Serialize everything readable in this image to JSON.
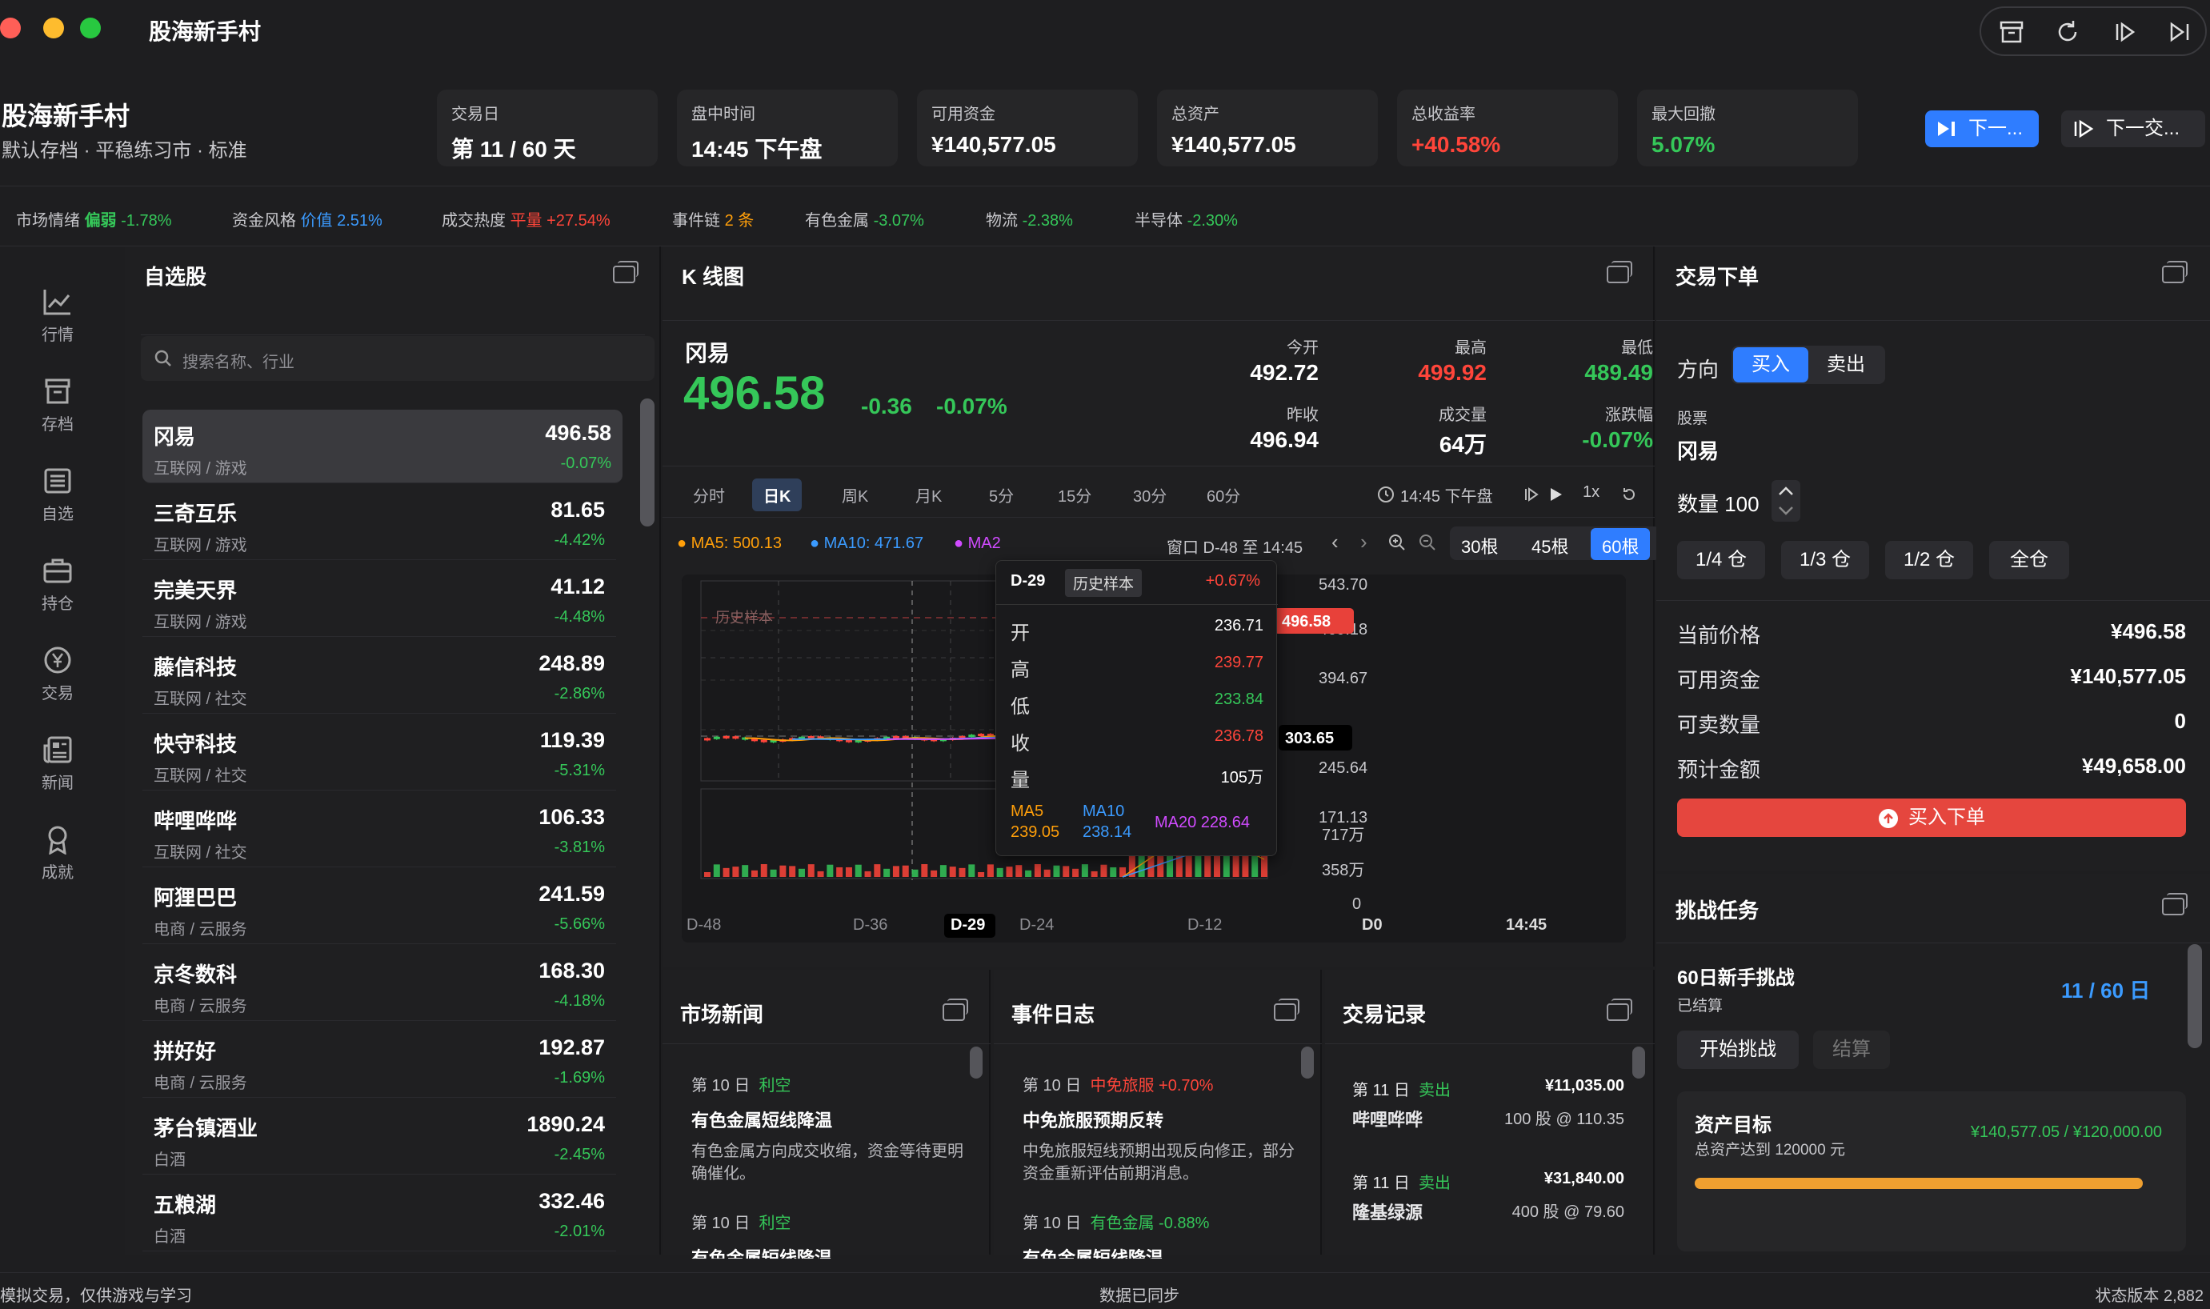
{
  "app": {
    "title": "股海新手村"
  },
  "header": {
    "title": "股海新手村",
    "subtitle": "默认存档 · 平稳练习市 · 标准",
    "stats": [
      {
        "label": "交易日",
        "value": "第 11 / 60 天"
      },
      {
        "label": "盘中时间",
        "value": "14:45 下午盘"
      },
      {
        "label": "可用资金",
        "value": "¥140,577.05"
      },
      {
        "label": "总资产",
        "value": "¥140,577.05"
      },
      {
        "label": "总收益率",
        "value": "+40.58%"
      },
      {
        "label": "最大回撤",
        "value": "5.07%"
      }
    ],
    "next_button": "下一...",
    "next_trade_button": "下一交..."
  },
  "ticker": [
    {
      "label": "市场情绪",
      "tag": "偏弱",
      "value": "-1.78%"
    },
    {
      "label": "资金风格",
      "tag": "价值",
      "value": "2.51%"
    },
    {
      "label": "成交热度",
      "tag": "平量",
      "value": "+27.54%"
    },
    {
      "label": "事件链",
      "tag": "",
      "value": "2 条"
    },
    {
      "label": "有色金属",
      "tag": "",
      "value": "-3.07%"
    },
    {
      "label": "物流",
      "tag": "",
      "value": "-2.38%"
    },
    {
      "label": "半导体",
      "tag": "",
      "value": "-2.30%"
    }
  ],
  "sidebar": {
    "items": [
      "行情",
      "存档",
      "自选",
      "持仓",
      "交易",
      "新闻",
      "成就"
    ]
  },
  "watchlist": {
    "title": "自选股",
    "search_placeholder": "搜索名称、行业",
    "stocks": [
      {
        "name": "冈易",
        "sector": "互联网 / 游戏",
        "price": "496.58",
        "change": "-0.07%"
      },
      {
        "name": "三奇互乐",
        "sector": "互联网 / 游戏",
        "price": "81.65",
        "change": "-4.42%"
      },
      {
        "name": "完美天界",
        "sector": "互联网 / 游戏",
        "price": "41.12",
        "change": "-4.48%"
      },
      {
        "name": "藤信科技",
        "sector": "互联网 / 社交",
        "price": "248.89",
        "change": "-2.86%"
      },
      {
        "name": "快守科技",
        "sector": "互联网 / 社交",
        "price": "119.39",
        "change": "-5.31%"
      },
      {
        "name": "哔哩哗哗",
        "sector": "互联网 / 社交",
        "price": "106.33",
        "change": "-3.81%"
      },
      {
        "name": "阿狸巴巴",
        "sector": "电商 / 云服务",
        "price": "241.59",
        "change": "-5.66%"
      },
      {
        "name": "京冬数科",
        "sector": "电商 / 云服务",
        "price": "168.30",
        "change": "-4.18%"
      },
      {
        "name": "拼好好",
        "sector": "电商 / 云服务",
        "price": "192.87",
        "change": "-1.69%"
      },
      {
        "name": "茅台镇酒业",
        "sector": "白酒",
        "price": "1890.24",
        "change": "-2.45%"
      },
      {
        "name": "五粮湖",
        "sector": "白酒",
        "price": "332.46",
        "change": "-2.01%"
      }
    ]
  },
  "kline": {
    "title": "K 线图",
    "stock_name": "冈易",
    "price": "496.58",
    "change": "-0.36",
    "change_pct": "-0.07%",
    "quote": [
      {
        "label": "今开",
        "value": "492.72"
      },
      {
        "label": "最高",
        "value": "499.92"
      },
      {
        "label": "最低",
        "value": "489.49"
      },
      {
        "label": "昨收",
        "value": "496.94"
      },
      {
        "label": "成交量",
        "value": "64万"
      },
      {
        "label": "涨跌幅",
        "value": "-0.07%"
      }
    ],
    "tabs": [
      "分时",
      "日K",
      "周K",
      "月K",
      "5分",
      "15分",
      "30分",
      "60分"
    ],
    "active_tab": "日K",
    "time_label": "14:45 下午盘",
    "speed": "1x",
    "ma": {
      "ma5": "MA5: 500.13",
      "ma10": "MA10: 471.67",
      "ma20": "MA2"
    },
    "window": "窗口 D-48 至 14:45",
    "bar_counts": [
      "30根",
      "45根",
      "60根"
    ],
    "active_count": "60根",
    "history_label": "历史样本",
    "y_ticks": [
      "543.70",
      "469.18",
      "394.67",
      "245.64",
      "171.13"
    ],
    "price_tag": "496.58",
    "cross_tag": "303.65",
    "vol_ticks": [
      "717万",
      "358万",
      "0"
    ],
    "x_ticks": [
      "D-48",
      "D-36",
      "D-29",
      "D-24",
      "D-12",
      "D0",
      "14:45"
    ],
    "colors": {
      "up": "#ff453a",
      "down": "#35c759",
      "ma5": "#ff9f0a",
      "ma10": "#3b9bff",
      "ma20": "#d04bff"
    },
    "tooltip": {
      "day": "D-29",
      "tag": "历史样本",
      "pct": "+0.67%",
      "rows": [
        {
          "k": "开",
          "v": "236.71"
        },
        {
          "k": "高",
          "v": "239.77"
        },
        {
          "k": "低",
          "v": "233.84"
        },
        {
          "k": "收",
          "v": "236.78"
        },
        {
          "k": "量",
          "v": "105万"
        }
      ],
      "ma5_label": "MA5",
      "ma5": "239.05",
      "ma10_label": "MA10",
      "ma10": "238.14",
      "ma20": "MA20 228.64"
    }
  },
  "order": {
    "title": "交易下单",
    "direction_label": "方向",
    "buy": "买入",
    "sell": "卖出",
    "stock_label": "股票",
    "stock": "冈易",
    "qty": "数量 100",
    "positions": [
      "1/4 仓",
      "1/3 仓",
      "1/2 仓",
      "全仓"
    ],
    "rows": [
      {
        "k": "当前价格",
        "v": "¥496.58"
      },
      {
        "k": "可用资金",
        "v": "¥140,577.05"
      },
      {
        "k": "可卖数量",
        "v": "0"
      },
      {
        "k": "预计金额",
        "v": "¥49,658.00"
      }
    ],
    "submit": "买入下单"
  },
  "challenge": {
    "title": "挑战任务",
    "name": "60日新手挑战",
    "status": "已结算",
    "days": "11 / 60 日",
    "start": "开始挑战",
    "settle": "结算",
    "goal_title": "资产目标",
    "goal_desc": "总资产达到 120000 元",
    "goal_value": "¥140,577.05 / ¥120,000.00",
    "progress": 1.0
  },
  "news": {
    "title": "市场新闻",
    "items": [
      {
        "day": "第 10 日",
        "tag": "利空",
        "head": "有色金属短线降温",
        "body": "有色金属方向成交收缩，资金等待更明确催化。"
      },
      {
        "day": "第 10 日",
        "tag": "利空",
        "head": "有色金属短线降温",
        "body": ""
      }
    ]
  },
  "events": {
    "title": "事件日志",
    "items": [
      {
        "day": "第 10 日",
        "tag": "中免旅服 +0.70%",
        "head": "中免旅服预期反转",
        "body": "中免旅服短线预期出现反向修正，部分资金重新评估前期消息。"
      },
      {
        "day": "第 10 日",
        "tag": "有色金属 -0.88%",
        "head": "有色金属短线降温",
        "body": ""
      }
    ]
  },
  "trades": {
    "title": "交易记录",
    "items": [
      {
        "day": "第 11 日",
        "side": "卖出",
        "amount": "¥11,035.00",
        "name": "哔哩哗哗",
        "detail": "100 股 @ 110.35"
      },
      {
        "day": "第 11 日",
        "side": "卖出",
        "amount": "¥31,840.00",
        "name": "隆基绿源",
        "detail": "400 股 @ 79.60"
      }
    ]
  },
  "footer": {
    "left": "模拟交易，仅供游戏与学习",
    "center": "数据已同步",
    "right": "状态版本 2,882"
  }
}
